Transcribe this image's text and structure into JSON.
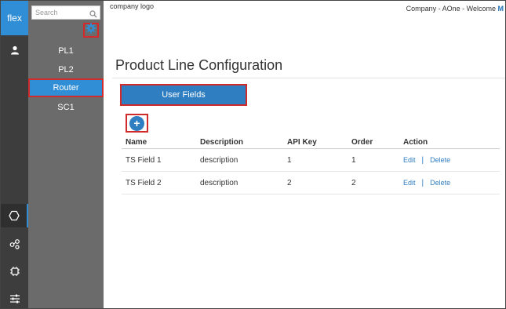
{
  "rail": {
    "logo_text": "flex",
    "accent": "#2f8ed5",
    "icons": [
      "user-icon",
      "hexagon-icon",
      "share-nodes-icon",
      "chip-icon",
      "sliders-icon"
    ]
  },
  "sidebar": {
    "search_placeholder": "Search",
    "items": [
      {
        "label": "PL1"
      },
      {
        "label": "PL2"
      },
      {
        "label": "Router",
        "selected": true
      },
      {
        "label": "SC1"
      }
    ]
  },
  "header": {
    "company_logo": "company logo",
    "welcome_text": "Company - AOne - Welcome ",
    "welcome_user": "M"
  },
  "main": {
    "title": "Product Line Configuration",
    "tab_label": "User Fields",
    "add_label": "+",
    "columns": [
      "Name",
      "Description",
      "API Key",
      "Order",
      "Action"
    ],
    "rows": [
      {
        "name": "TS Field 1",
        "description": "description",
        "api_key": "1",
        "order": "1",
        "edit": "Edit",
        "sep": "|",
        "delete": "Delete"
      },
      {
        "name": "TS Field 2",
        "description": "description",
        "api_key": "2",
        "order": "2",
        "edit": "Edit",
        "sep": "|",
        "delete": "Delete"
      }
    ]
  }
}
